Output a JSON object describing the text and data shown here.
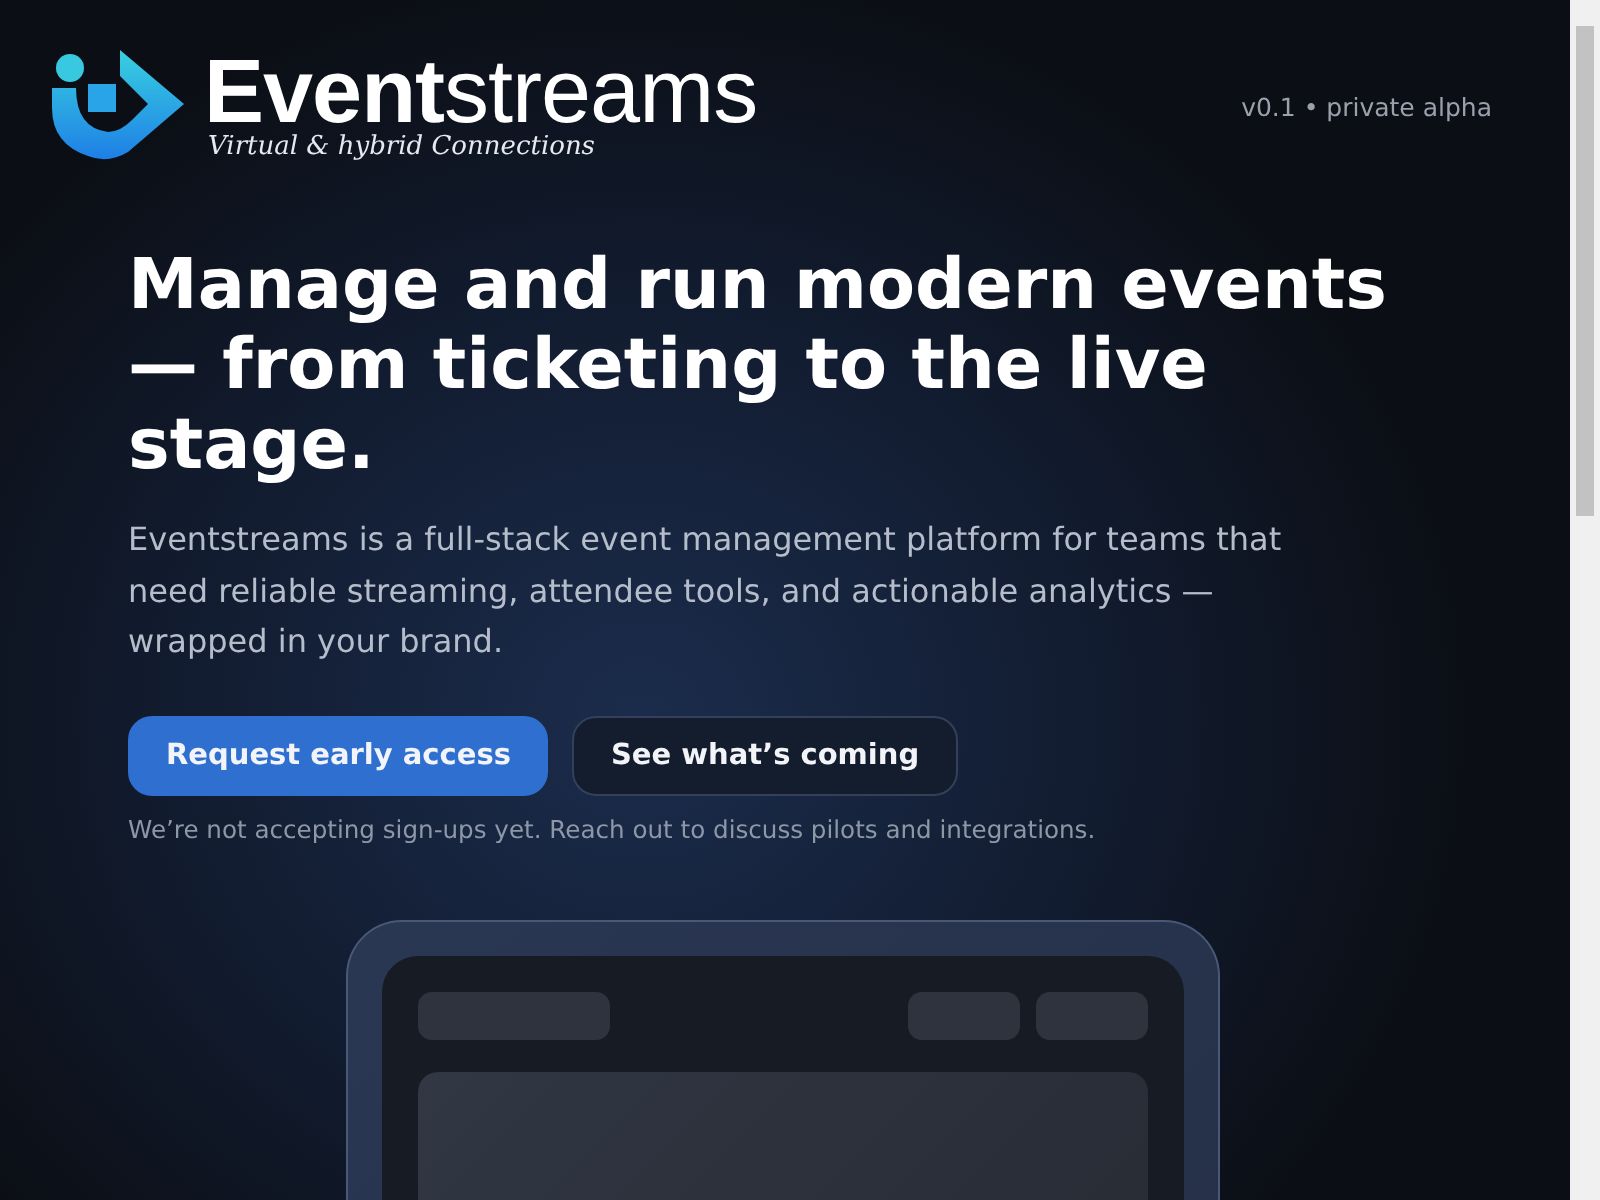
{
  "brand": {
    "name": "**Event**streams",
    "tagline": "Virtual & hybrid Connections"
  },
  "version": "v0.1 • private alpha",
  "hero": {
    "title": "Manage and run modern events — from ticketing to the live stage.",
    "description": "Eventstreams is a full-stack event management platform for teams that need reliable streaming, attendee tools, and actionable analytics — wrapped in your brand.",
    "buttons": [
      {
        "label": "Request early access",
        "kind": "primary"
      },
      {
        "label": "See what’s coming",
        "kind": "secondary"
      }
    ],
    "note": "We’re not accepting sign-ups yet. Reach out to discuss pilots and integrations."
  }
}
